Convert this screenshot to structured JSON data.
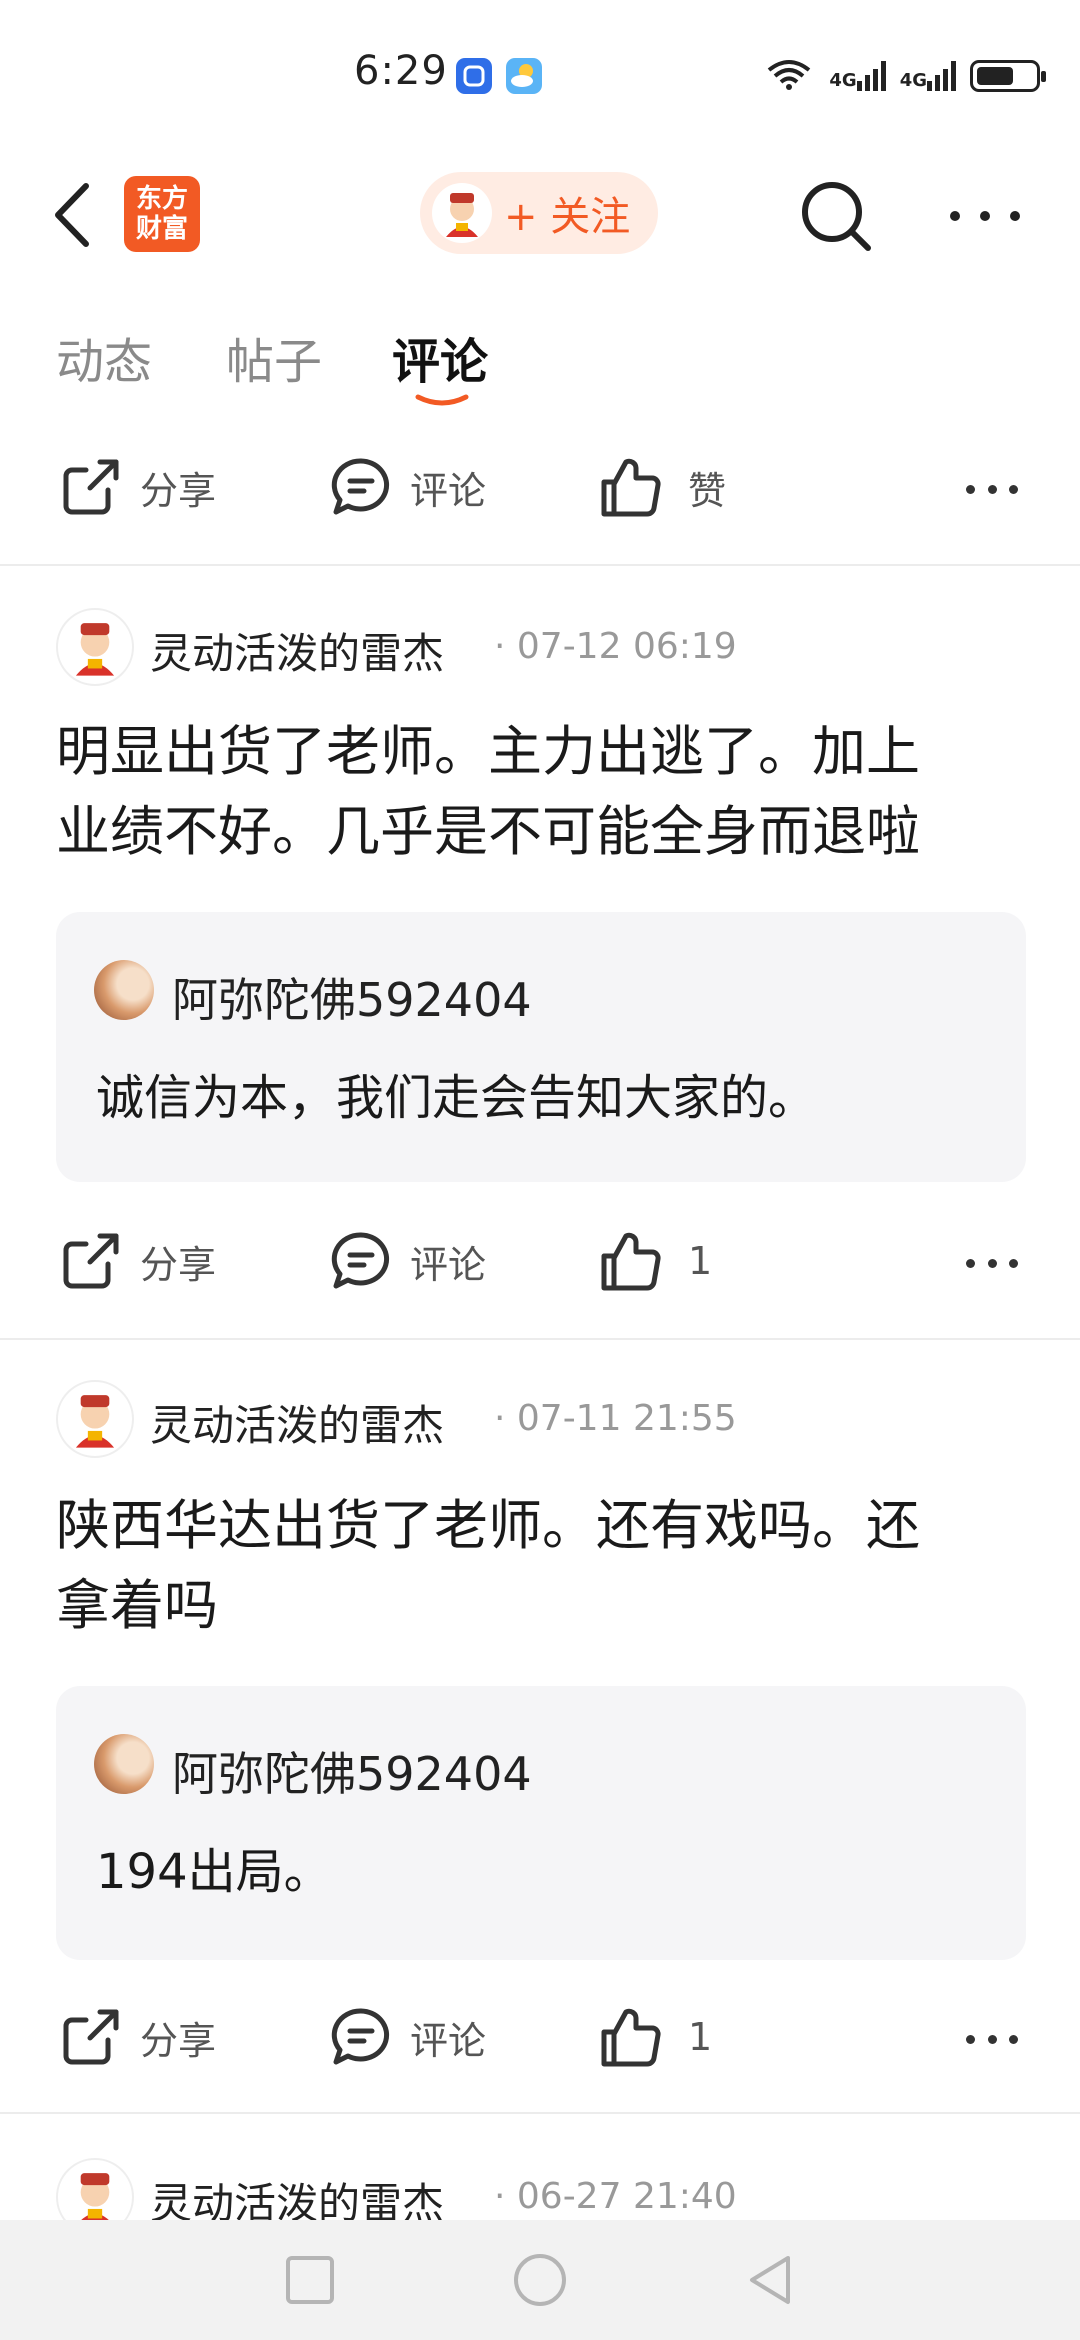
{
  "status_bar": {
    "time": "6:29",
    "network": [
      "4G",
      "4G"
    ],
    "wifi_label": "6",
    "battery_percent": 70
  },
  "header": {
    "logo_line1": "东方",
    "logo_line2": "财富",
    "follow_label": "+ 关注"
  },
  "tabs": [
    {
      "label": "动态",
      "active": false
    },
    {
      "label": "帖子",
      "active": false
    },
    {
      "label": "评论",
      "active": true
    }
  ],
  "actions": {
    "share": "分享",
    "comment": "评论",
    "like": "赞"
  },
  "comments": [
    {
      "user": "灵动活泼的雷杰",
      "time": "· 07-12 06:19",
      "text": [
        "明显出货了老师。主力出逃了。加上",
        "业绩不好。几乎是不可能全身而退啦"
      ],
      "reply": {
        "user": "阿弥陀佛592404",
        "text": "诚信为本，我们走会告知大家的。"
      },
      "likes": "1"
    },
    {
      "user": "灵动活泼的雷杰",
      "time": "· 07-11 21:55",
      "text": [
        "陕西华达出货了老师。还有戏吗。还",
        "拿着吗"
      ],
      "reply": {
        "user": "阿弥陀佛592404",
        "text": "194出局。"
      },
      "likes": "1"
    },
    {
      "user": "灵动活泼的雷杰",
      "time": "· 06-27 21:40"
    }
  ],
  "colors": {
    "accent": "#f25a24",
    "reply_bg": "#f5f5f7"
  }
}
